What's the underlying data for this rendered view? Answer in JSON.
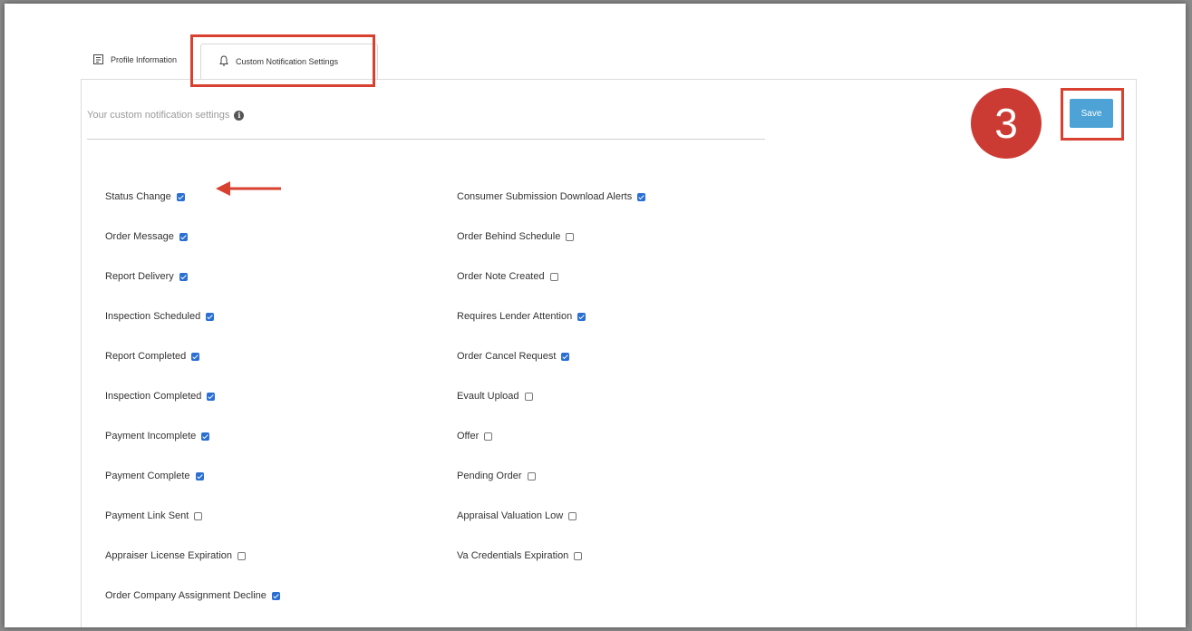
{
  "tabs": [
    {
      "label": "Profile Information",
      "icon": "profile-card-icon",
      "active": false
    },
    {
      "label": "Custom Notification Settings",
      "icon": "bell-icon",
      "active": true
    }
  ],
  "section": {
    "title": "Your custom notification settings",
    "info_icon": "info-icon"
  },
  "save_label": "Save",
  "step_number": "3",
  "colors": {
    "highlight": "#d8402f",
    "step": "#cc3b33",
    "save": "#4da3d6",
    "checkbox": "#2a6fd4"
  },
  "left_options": [
    {
      "label": "Status Change",
      "checked": true
    },
    {
      "label": "Order Message",
      "checked": true
    },
    {
      "label": "Report Delivery",
      "checked": true
    },
    {
      "label": "Inspection Scheduled",
      "checked": true
    },
    {
      "label": "Report Completed",
      "checked": true
    },
    {
      "label": "Inspection Completed",
      "checked": true
    },
    {
      "label": "Payment Incomplete",
      "checked": true
    },
    {
      "label": "Payment Complete",
      "checked": true
    },
    {
      "label": "Payment Link Sent",
      "checked": false
    },
    {
      "label": "Appraiser License Expiration",
      "checked": false
    },
    {
      "label": "Order Company Assignment Decline",
      "checked": true
    }
  ],
  "right_options": [
    {
      "label": "Consumer Submission Download Alerts",
      "checked": true
    },
    {
      "label": "Order Behind Schedule",
      "checked": false
    },
    {
      "label": "Order Note Created",
      "checked": false
    },
    {
      "label": "Requires Lender Attention",
      "checked": true
    },
    {
      "label": "Order Cancel Request",
      "checked": true
    },
    {
      "label": "Evault Upload",
      "checked": false
    },
    {
      "label": "Offer",
      "checked": false
    },
    {
      "label": "Pending Order",
      "checked": false
    },
    {
      "label": "Appraisal Valuation Low",
      "checked": false
    },
    {
      "label": "Va Credentials Expiration",
      "checked": false
    }
  ]
}
